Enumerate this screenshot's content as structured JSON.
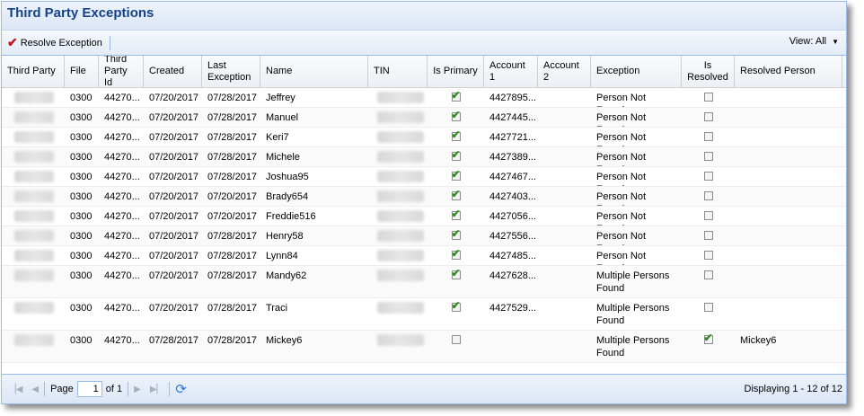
{
  "window": {
    "title": "Third Party Exceptions"
  },
  "toolbar": {
    "resolve_label": "Resolve Exception",
    "view_label": "View: All"
  },
  "columns": [
    "Third Party",
    "File",
    "Third Party Id",
    "Created",
    "Last Exception",
    "Name",
    "TIN",
    "Is Primary",
    "Account 1",
    "Account 2",
    "Exception",
    "Is Resolved",
    "Resolved Person"
  ],
  "rows": [
    {
      "file": "0300",
      "tp_id": "44270...",
      "created": "07/20/2017",
      "last_exception": "07/28/2017",
      "name": "Jeffrey",
      "is_primary": true,
      "account1": "4427895...",
      "account2": "",
      "exception": "Person Not Found",
      "is_resolved": false,
      "resolved_person": ""
    },
    {
      "file": "0300",
      "tp_id": "44270...",
      "created": "07/20/2017",
      "last_exception": "07/28/2017",
      "name": "Manuel",
      "is_primary": true,
      "account1": "4427445...",
      "account2": "",
      "exception": "Person Not Found",
      "is_resolved": false,
      "resolved_person": ""
    },
    {
      "file": "0300",
      "tp_id": "44270...",
      "created": "07/20/2017",
      "last_exception": "07/28/2017",
      "name": "Keri7",
      "is_primary": true,
      "account1": "4427721...",
      "account2": "",
      "exception": "Person Not Found",
      "is_resolved": false,
      "resolved_person": ""
    },
    {
      "file": "0300",
      "tp_id": "44270...",
      "created": "07/20/2017",
      "last_exception": "07/28/2017",
      "name": "Michele",
      "is_primary": true,
      "account1": "4427389...",
      "account2": "",
      "exception": "Person Not Found",
      "is_resolved": false,
      "resolved_person": ""
    },
    {
      "file": "0300",
      "tp_id": "44270...",
      "created": "07/20/2017",
      "last_exception": "07/28/2017",
      "name": "Joshua95",
      "is_primary": true,
      "account1": "4427467...",
      "account2": "",
      "exception": "Person Not Found",
      "is_resolved": false,
      "resolved_person": ""
    },
    {
      "file": "0300",
      "tp_id": "44270...",
      "created": "07/20/2017",
      "last_exception": "07/20/2017",
      "name": "Brady654",
      "is_primary": true,
      "account1": "4427403...",
      "account2": "",
      "exception": "Person Not Found",
      "is_resolved": false,
      "resolved_person": ""
    },
    {
      "file": "0300",
      "tp_id": "44270...",
      "created": "07/20/2017",
      "last_exception": "07/20/2017",
      "name": "Freddie516",
      "is_primary": true,
      "account1": "4427056...",
      "account2": "",
      "exception": "Person Not Found",
      "is_resolved": false,
      "resolved_person": ""
    },
    {
      "file": "0300",
      "tp_id": "44270...",
      "created": "07/20/2017",
      "last_exception": "07/28/2017",
      "name": "Henry58",
      "is_primary": true,
      "account1": "4427556...",
      "account2": "",
      "exception": "Person Not Found",
      "is_resolved": false,
      "resolved_person": ""
    },
    {
      "file": "0300",
      "tp_id": "44270...",
      "created": "07/20/2017",
      "last_exception": "07/28/2017",
      "name": "Lynn84",
      "is_primary": true,
      "account1": "4427485...",
      "account2": "",
      "exception": "Person Not Found",
      "is_resolved": false,
      "resolved_person": ""
    },
    {
      "file": "0300",
      "tp_id": "44270...",
      "created": "07/20/2017",
      "last_exception": "07/28/2017",
      "name": "Mandy62",
      "is_primary": true,
      "account1": "4427628...",
      "account2": "",
      "exception": "Multiple Persons Found",
      "is_resolved": false,
      "resolved_person": ""
    },
    {
      "file": "0300",
      "tp_id": "44270...",
      "created": "07/20/2017",
      "last_exception": "07/28/2017",
      "name": "Traci",
      "is_primary": true,
      "account1": "4427529...",
      "account2": "",
      "exception": "Multiple Persons Found",
      "is_resolved": false,
      "resolved_person": ""
    },
    {
      "file": "0300",
      "tp_id": "44270...",
      "created": "07/28/2017",
      "last_exception": "07/28/2017",
      "name": "Mickey6",
      "is_primary": false,
      "account1": "",
      "account2": "",
      "exception": "Multiple Persons Found",
      "is_resolved": true,
      "resolved_person": "Mickey6"
    }
  ],
  "pager": {
    "page_label": "Page",
    "page_value": "1",
    "of_label": "of 1",
    "displaying": "Displaying 1 - 12 of 12"
  },
  "icons": {
    "resolve": "red-checkmark-icon",
    "first": "first-page-icon",
    "prev": "prev-page-icon",
    "next": "next-page-icon",
    "last": "last-page-icon",
    "refresh": "refresh-icon"
  },
  "colors": {
    "title": "#15428b",
    "border": "#99bbe8",
    "check": "#2f8a1f",
    "resolve_icon": "#c0181e"
  }
}
